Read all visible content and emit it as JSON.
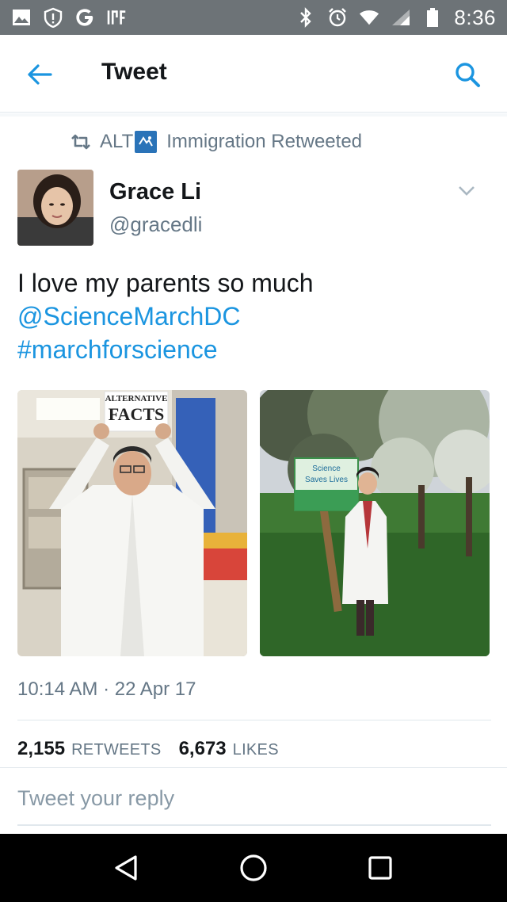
{
  "status_bar": {
    "time": "8:36",
    "icons_left": [
      "image-icon",
      "alert-icon",
      "google-icon",
      "app-icon"
    ],
    "icons_right": [
      "bluetooth-icon",
      "alarm-icon",
      "wifi-icon",
      "signal-icon",
      "battery-icon"
    ]
  },
  "header": {
    "title": "Tweet",
    "back_icon": "arrow-left-icon",
    "search_icon": "search-icon",
    "accent_color": "#1b95e0"
  },
  "retweet_banner": {
    "prefix": "ALT",
    "text": "Immigration Retweeted"
  },
  "author": {
    "name": "Grace Li",
    "handle": "@gracedli"
  },
  "tweet": {
    "text_plain": "I love my parents so much",
    "mention": "@ScienceMarchDC",
    "hashtag": "#marchforscience",
    "timestamp": "10:14 AM · 22 Apr 17"
  },
  "photos": {
    "left_sign_line1": "ALTERNATIVE",
    "left_sign_line2": "FACTS",
    "right_sign_line1": "Science",
    "right_sign_line2": "Saves Lives"
  },
  "stats": {
    "retweets_count": "2,155",
    "retweets_label": "RETWEETS",
    "likes_count": "6,673",
    "likes_label": "LIKES"
  },
  "reply": {
    "placeholder": "Tweet your reply"
  },
  "nav": {
    "back": "nav-back-icon",
    "home": "nav-home-icon",
    "recents": "nav-recents-icon"
  }
}
